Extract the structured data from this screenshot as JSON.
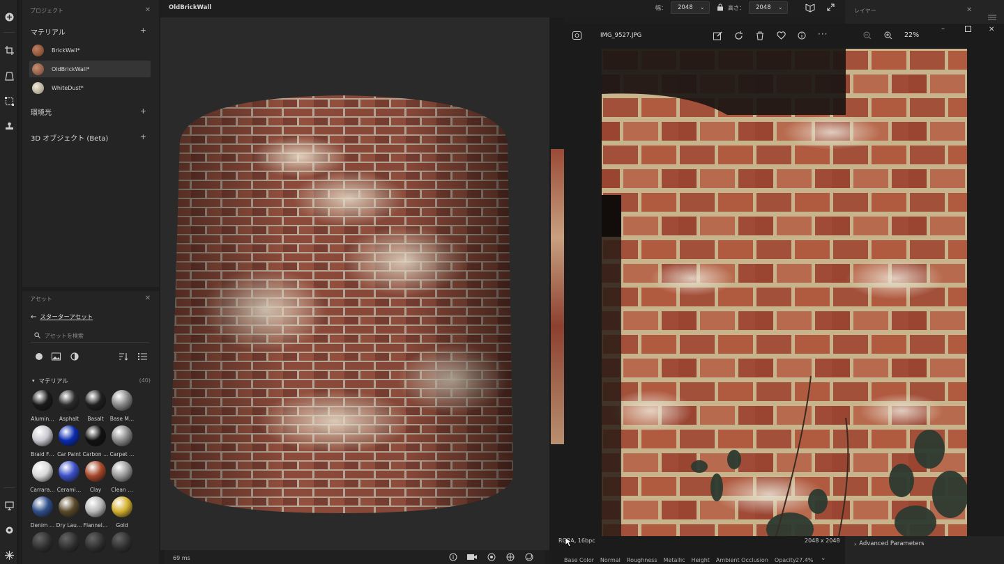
{
  "toolbar": {
    "icons": [
      "add-icon",
      "crop-icon",
      "perspective-icon",
      "transform-icon",
      "stamp-icon",
      "display-icon",
      "settings-icon",
      "puzzle-icon"
    ]
  },
  "project": {
    "title": "プロジェクト",
    "materials_label": "マテリアル",
    "materials": [
      {
        "name": "BrickWall*"
      },
      {
        "name": "OldBrickWall*"
      },
      {
        "name": "WhiteDust*"
      }
    ],
    "environment_label": "環境光",
    "objects_label": "3D オブジェクト (Beta)"
  },
  "assets": {
    "title": "アセット",
    "back_label": "スターターアセット",
    "search_placeholder": "アセットを検索",
    "section_label": "マテリアル",
    "section_count": "(40)",
    "items": [
      {
        "label": "Alumin…",
        "color": "#1a1a1a"
      },
      {
        "label": "Asphalt",
        "color": "#2a2a2a"
      },
      {
        "label": "Basalt",
        "color": "#1f1f1f"
      },
      {
        "label": "Base M…",
        "color": "#888888"
      },
      {
        "label": "Braid F…",
        "color": "#c8c8d0"
      },
      {
        "label": "Car Paint",
        "color": "#0a2bb0"
      },
      {
        "label": "Carbon …",
        "color": "#111111"
      },
      {
        "label": "Carpet …",
        "color": "#8a8a8a"
      },
      {
        "label": "Carrara…",
        "color": "#d8d8d8"
      },
      {
        "label": "Cerami…",
        "color": "#3a4fc8"
      },
      {
        "label": "Clay",
        "color": "#a8482a"
      },
      {
        "label": "Clean …",
        "color": "#9a9a9a"
      },
      {
        "label": "Denim …",
        "color": "#2f4f8a"
      },
      {
        "label": "Dry Lau…",
        "color": "#5a4a2a"
      },
      {
        "label": "Flannel…",
        "color": "#b8b8b8"
      },
      {
        "label": "Gold",
        "color": "#d4b030"
      }
    ]
  },
  "viewport": {
    "title": "OldBrickWall",
    "timing": "69 ms"
  },
  "header": {
    "width_label": "幅：",
    "width_value": "2048",
    "height_label": "高さ：",
    "height_value": "2048",
    "layers_label": "レイヤー"
  },
  "photo": {
    "filename": "IMG_9527.JPG",
    "zoom": "22%",
    "format": "RGBA, 16bpc",
    "dimensions": "2048 x 2048",
    "channels": [
      "Base Color",
      "Normal",
      "Roughness",
      "Metallic",
      "Height",
      "Ambient Occlusion",
      "Opacity"
    ],
    "channel_zoom": "27.4%",
    "advanced": "Advanced Parameters"
  }
}
